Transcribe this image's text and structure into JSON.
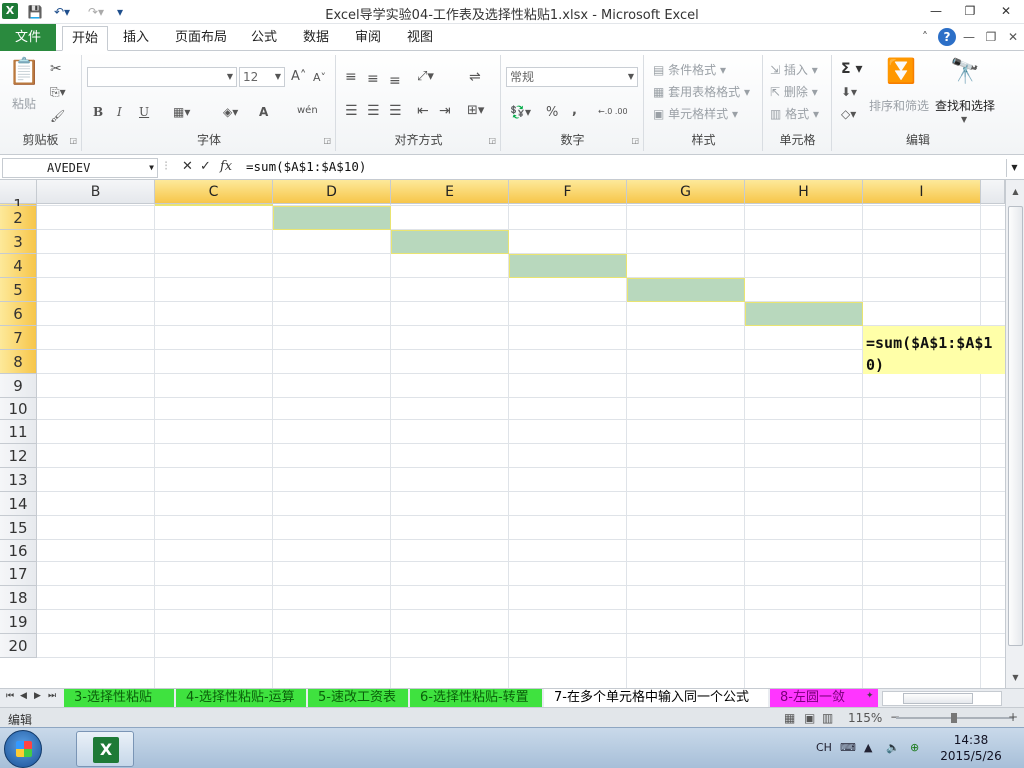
{
  "window": {
    "title": "Excel导学实验04-工作表及选择性粘贴1.xlsx - Microsoft Excel",
    "minimize": "—",
    "restore": "❐",
    "close": "✕"
  },
  "ribbon_tabs": {
    "file": "文件",
    "items": [
      "开始",
      "插入",
      "页面布局",
      "公式",
      "数据",
      "审阅",
      "视图"
    ],
    "active": "开始"
  },
  "ribbon": {
    "clipboard": {
      "label": "剪贴板",
      "paste": "粘贴"
    },
    "font": {
      "label": "字体",
      "font_name": "",
      "font_size": "12",
      "bold": "B",
      "italic": "I",
      "underline": "U",
      "grow": "A˄",
      "shrink": "A˅",
      "color": "A",
      "wen": "wén"
    },
    "alignment": {
      "label": "对齐方式"
    },
    "number": {
      "label": "数字",
      "format": "常规",
      "percent": "%",
      "comma": ",",
      "inc": "←.0 .00",
      "dec": ".00 →.0"
    },
    "styles": {
      "label": "样式",
      "conditional": "条件格式",
      "table": "套用表格格式",
      "cell_styles": "单元格样式"
    },
    "cells": {
      "label": "单元格",
      "insert": "插入",
      "delete": "删除",
      "format": "格式"
    },
    "editing": {
      "label": "编辑",
      "sort_filter": "排序和筛选",
      "find_select": "查找和选择",
      "sigma": "Σ"
    }
  },
  "formula_bar": {
    "name_box": "AVEDEV",
    "cancel": "✕",
    "enter": "✓",
    "fx": "fx",
    "formula": "=sum($A$1:$A$10)"
  },
  "grid": {
    "columns": [
      "B",
      "C",
      "D",
      "E",
      "F",
      "G",
      "H",
      "I"
    ],
    "selected_columns": [
      "C",
      "D",
      "E",
      "F",
      "G",
      "H",
      "I"
    ],
    "rows": [
      "1",
      "2",
      "3",
      "4",
      "5",
      "6",
      "7",
      "8",
      "9",
      "10",
      "11",
      "12",
      "13",
      "14",
      "15",
      "16",
      "17",
      "18",
      "19",
      "20"
    ],
    "selected_rows": [
      "1",
      "2",
      "3",
      "4",
      "5",
      "6",
      "7",
      "8"
    ],
    "editing_cell_text": "=sum($A$1:$A$10)",
    "colors": {
      "green_cell": "#b8d8bd",
      "edit_cell": "#ffffa8",
      "selected_header": "#f7c64a"
    }
  },
  "sheet_tabs": {
    "items": [
      {
        "label": "3-选择性粘贴",
        "style": "green"
      },
      {
        "label": "4-选择性粘贴-运算",
        "style": "green"
      },
      {
        "label": "5-速改工资表",
        "style": "green"
      },
      {
        "label": "6-选择性粘贴-转置",
        "style": "green"
      },
      {
        "label": "7-在多个单元格中输入同一个公式",
        "style": "active"
      },
      {
        "label": "8-左圆一敛",
        "style": "magenta"
      }
    ],
    "colors": {
      "green": "#3fe23f",
      "magenta": "#ff36ff"
    }
  },
  "status_bar": {
    "mode": "编辑",
    "zoom": "115%",
    "zoom_minus": "−",
    "zoom_plus": "+"
  },
  "taskbar": {
    "lang": "CH",
    "time": "14:38",
    "date": "2015/5/26"
  }
}
